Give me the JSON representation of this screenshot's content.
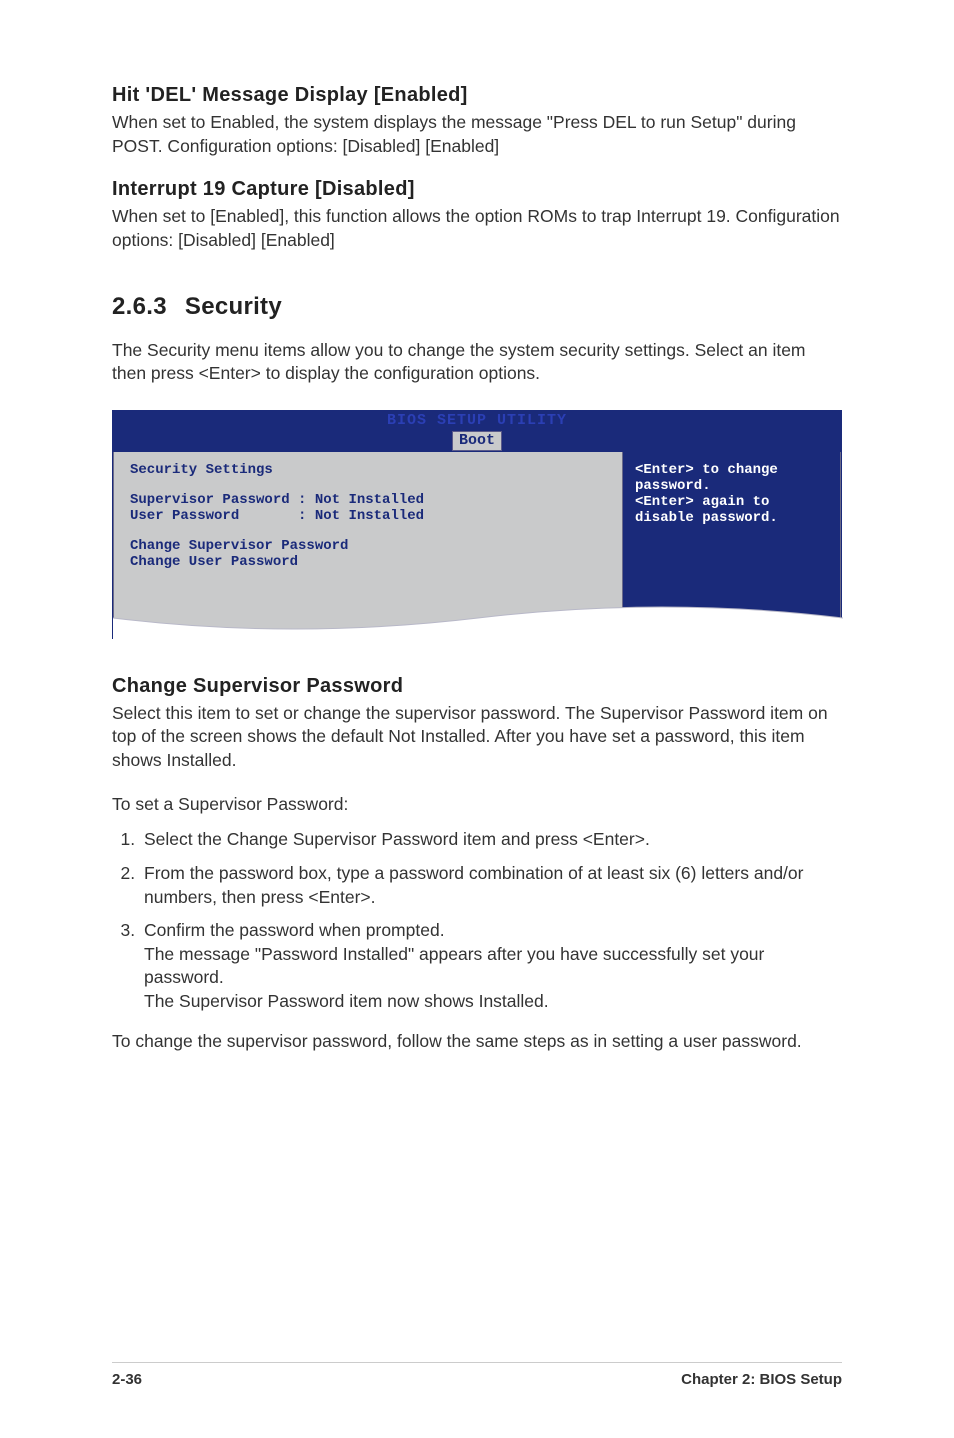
{
  "sections": {
    "hitDel": {
      "heading": "Hit 'DEL' Message Display [Enabled]",
      "text": "When set to Enabled, the system displays the message \"Press DEL to run Setup\" during POST. Configuration options: [Disabled] [Enabled]"
    },
    "interrupt19": {
      "heading": "Interrupt 19 Capture [Disabled]",
      "text": "When set to [Enabled], this function allows the option ROMs to trap Interrupt 19. Configuration options: [Disabled] [Enabled]"
    },
    "security": {
      "number": "2.6.3",
      "title": "Security",
      "intro": "The Security menu items allow you to change the system security settings. Select an item then press <Enter> to display the configuration options."
    },
    "changeSupervisor": {
      "heading": "Change Supervisor Password",
      "text1": "Select this item to set or change the supervisor password. The Supervisor Password item on top of the screen shows the default Not Installed. After you have set a password, this item shows Installed.",
      "text2": "To set a Supervisor Password:",
      "steps": {
        "s1": "Select the Change Supervisor Password item and press <Enter>.",
        "s2": "From the password box, type a password combination of at least six (6) letters and/or numbers, then press <Enter>.",
        "s3a": "Confirm the password when prompted.",
        "s3b": "The message \"Password Installed\" appears after you have successfully set your password.",
        "s3c": "The Supervisor Password item now shows Installed."
      },
      "text3": "To change the supervisor password, follow the same steps as in setting a user password."
    }
  },
  "bios": {
    "title": "BIOS SETUP UTILITY",
    "tab": "Boot",
    "left": {
      "secTitle": "Security Settings",
      "supLabel": "Supervisor Password",
      "supValue": ": Not Installed",
      "userLabel": "User Password",
      "userValue": ": Not Installed",
      "changeSup": "Change Supervisor Password",
      "changeUser": "Change User Password"
    },
    "right": {
      "line1": "<Enter> to change",
      "line2": "password.",
      "line3": "<Enter> again to",
      "line4": "disable password."
    }
  },
  "footer": {
    "page": "2-36",
    "chapter": "Chapter 2: BIOS Setup"
  }
}
